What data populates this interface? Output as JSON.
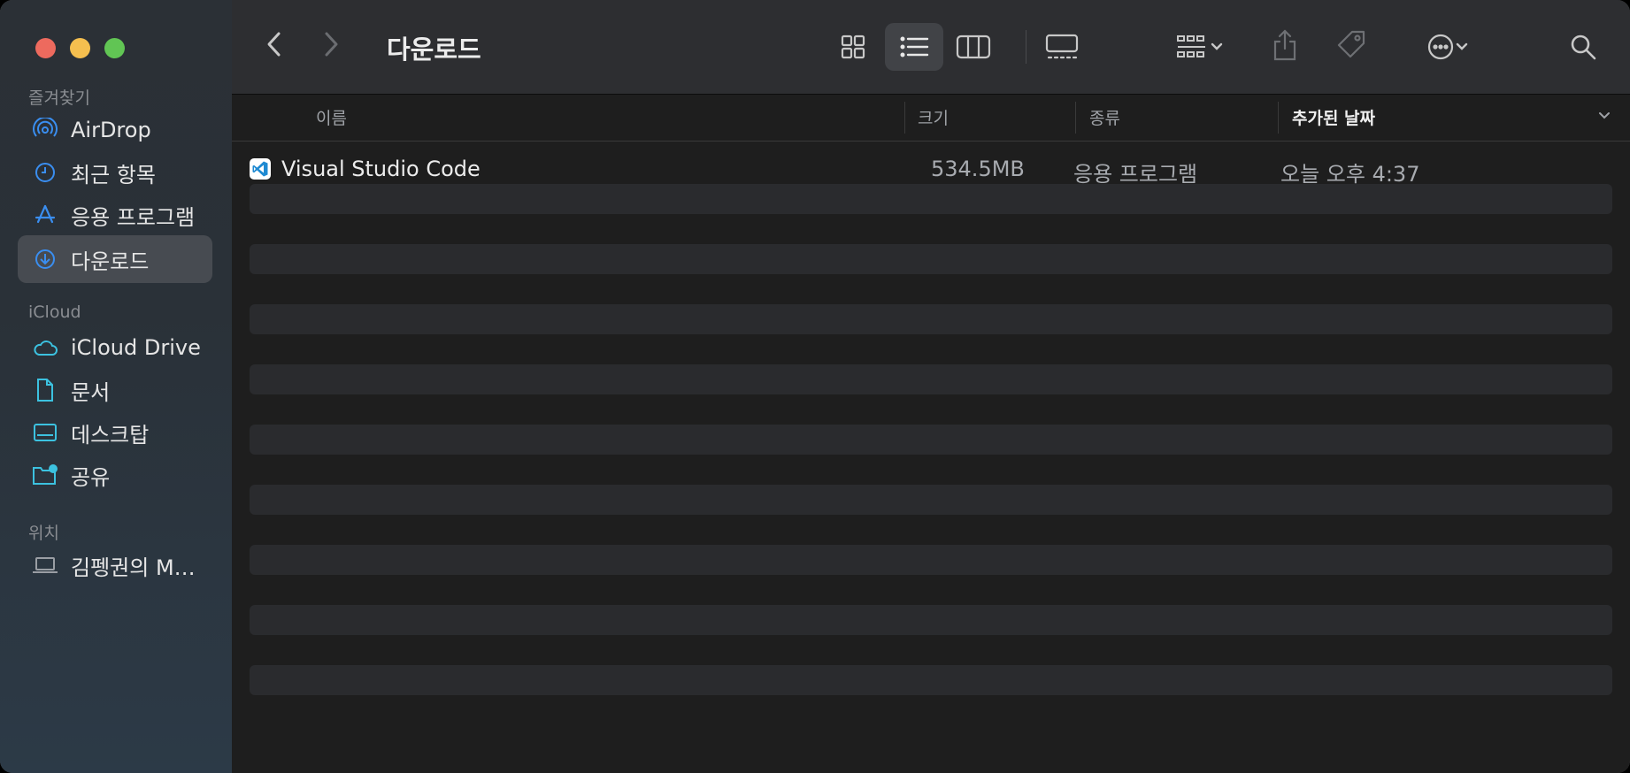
{
  "window": {
    "title": "다운로드"
  },
  "sidebar": {
    "sections": [
      {
        "label": "즐겨찾기"
      },
      {
        "label": "iCloud"
      },
      {
        "label": "위치"
      }
    ],
    "items": [
      {
        "label": "AirDrop",
        "icon": "airdrop-icon"
      },
      {
        "label": "최근 항목",
        "icon": "clock-icon"
      },
      {
        "label": "응용 프로그램",
        "icon": "apps-icon"
      },
      {
        "label": "다운로드",
        "icon": "download-icon",
        "selected": true
      },
      {
        "label": "iCloud Drive",
        "icon": "cloud-icon"
      },
      {
        "label": "문서",
        "icon": "document-icon"
      },
      {
        "label": "데스크탑",
        "icon": "desktop-icon"
      },
      {
        "label": "공유",
        "icon": "shared-folder-icon"
      },
      {
        "label": "김펭권의 MacBook",
        "icon": "laptop-icon"
      }
    ]
  },
  "columns": {
    "name": "이름",
    "size": "크기",
    "kind": "종류",
    "date_added": "추가된 날짜"
  },
  "files": [
    {
      "name": "Visual Studio Code",
      "size": "534.5MB",
      "kind": "응용 프로그램",
      "date_added": "오늘 오후 4:37"
    }
  ],
  "colors": {
    "accent": "#3a8ef0",
    "selected_bg": "#474b51",
    "traffic_red": "#ed6a5e",
    "traffic_yellow": "#f5bf4f",
    "traffic_green": "#61c554"
  }
}
